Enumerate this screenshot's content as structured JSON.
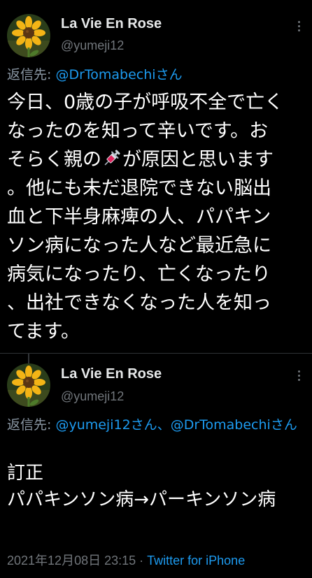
{
  "tweets": [
    {
      "display_name": "La Vie En Rose",
      "handle": "@yumeji12",
      "avatar_icon": "sunflower-avatar",
      "reply_prefix": "返信先: ",
      "reply_mention_1": "@DrTomabechi",
      "reply_suffix_1": "さん",
      "body_part_1": "今日、0歳の子が呼吸不全で亡くなったのを知って辛いです。おそらく親の",
      "body_emoji": "syringe-icon",
      "body_part_2": "が原因と思います。他にも未だ退院できない脳出血と下半身麻痺の人、パパキンソン病になった人など最近急に病気になったり、亡くなったり、出社できなくなった人を知ってます。"
    },
    {
      "display_name": "La Vie En Rose",
      "handle": "@yumeji12",
      "avatar_icon": "sunflower-avatar",
      "reply_prefix": "返信先: ",
      "reply_mention_1": "@yumeji12",
      "reply_suffix_1": "さん、",
      "reply_mention_2": "@DrTomabechi",
      "reply_suffix_2": "さん",
      "body_line_1": "訂正",
      "body_line_2": "パパキンソン病→パーキンソン病",
      "timestamp": "2021年12月08日 23:15",
      "separator": " · ",
      "source": "Twitter for iPhone"
    }
  ],
  "colors": {
    "background": "#000000",
    "text": "#ffffff",
    "secondary": "#71767b",
    "link": "#1d9bf0"
  }
}
